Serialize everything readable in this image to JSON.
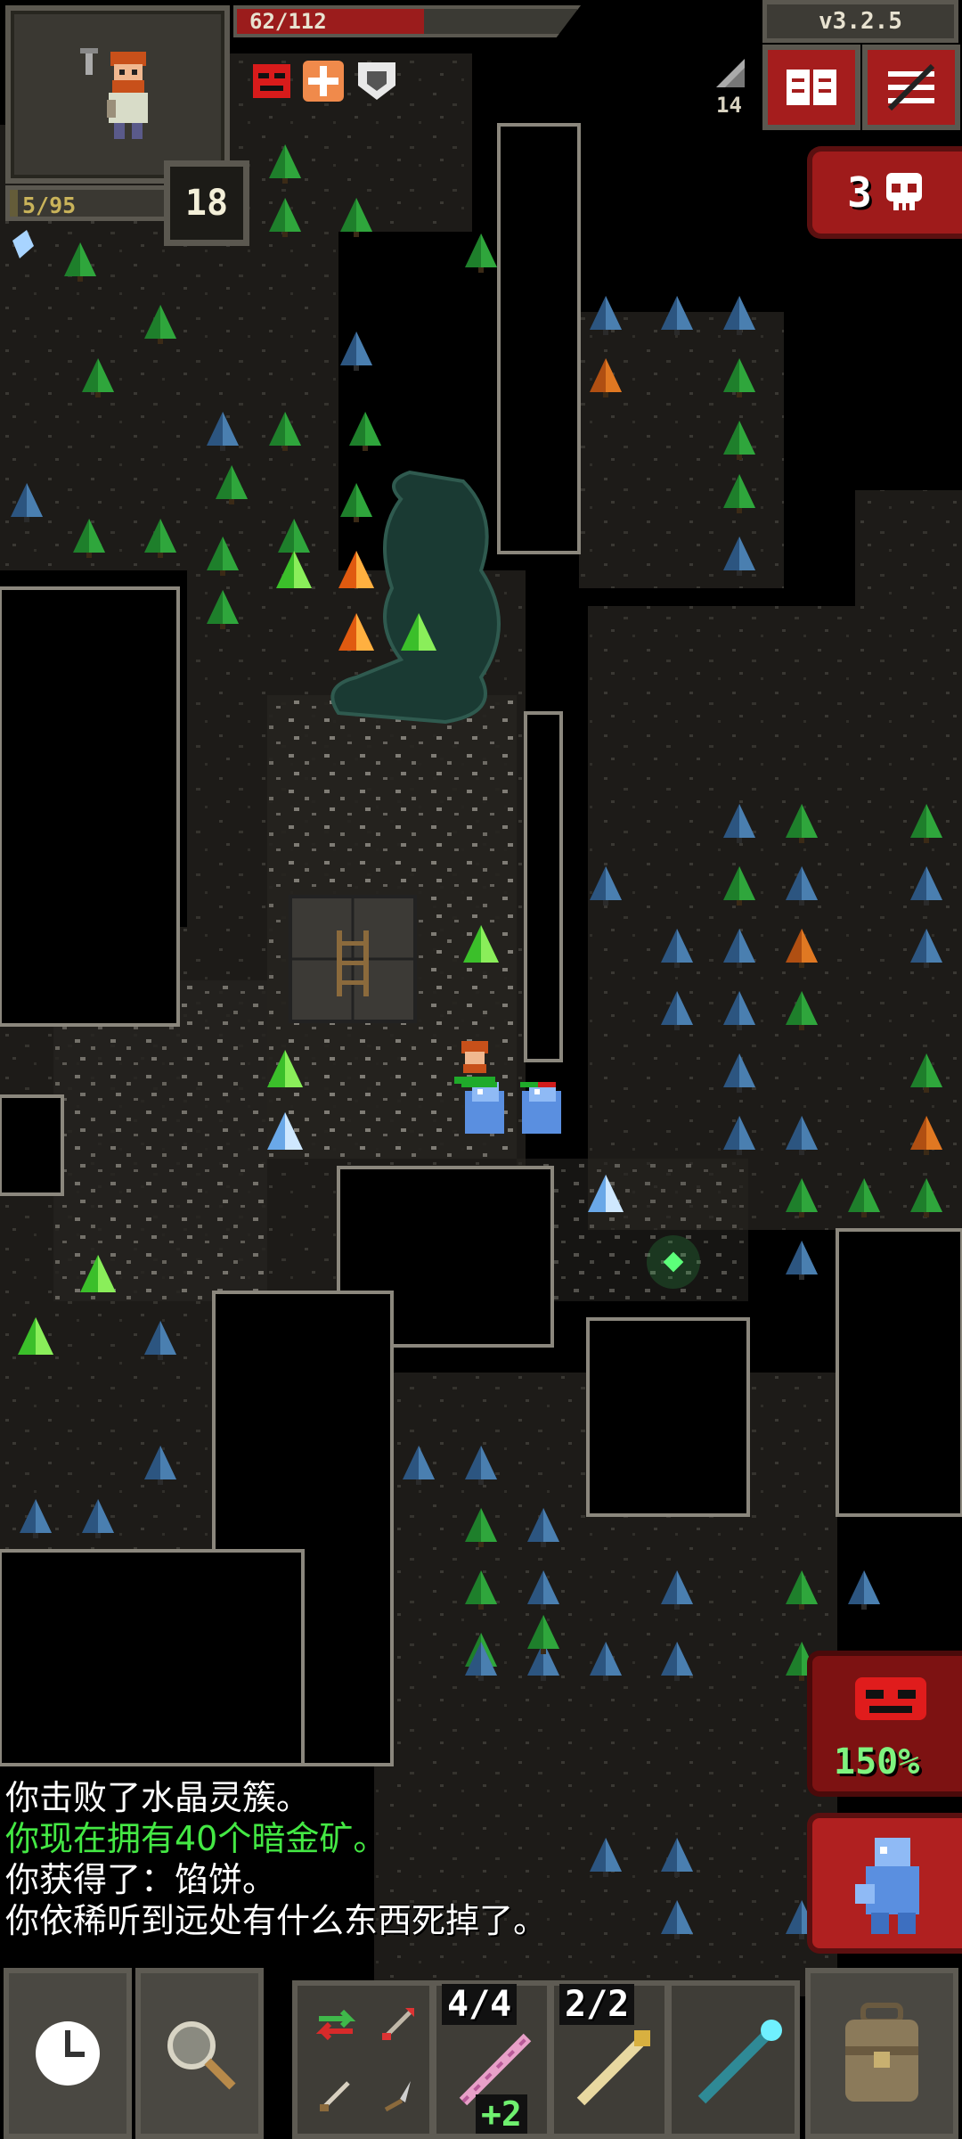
{
  "hero": {
    "hp_text": "62/112",
    "hp_fraction": 0.55,
    "exp_text": "5/95",
    "exp_fraction": 0.05,
    "level": "18"
  },
  "buffs": [
    {
      "icon": "rage-mask-icon",
      "color": "#d81b1b"
    },
    {
      "icon": "cross-shield-icon",
      "color": "#f08a4b"
    },
    {
      "icon": "armor-shield-icon",
      "color": "#e8e8e8"
    }
  ],
  "version": "v3.2.5",
  "depth": "14",
  "top_buttons": [
    {
      "icon": "journal-icon"
    },
    {
      "icon": "menu-icon"
    }
  ],
  "danger": {
    "count": "3",
    "icon": "skull-icon"
  },
  "attack": {
    "percent": "150%",
    "icon": "enemy-mask-icon"
  },
  "target": {
    "icon": "crystal-spirit-icon"
  },
  "log": [
    {
      "text": "你击败了水晶灵簇。",
      "color": "#ffffff"
    },
    {
      "text": "你现在拥有40个暗金矿。",
      "color": "#44e844"
    },
    {
      "text": "你获得了：馅饼。",
      "color": "#ffffff"
    },
    {
      "text": "你依稀听到远处有什么东西死掉了。",
      "color": "#ffffff"
    }
  ],
  "toolbar": {
    "wait_icon": "clock-icon",
    "search_icon": "magnifier-icon",
    "quickslots": [
      {
        "icon": "swap-arrows-icon"
      },
      {
        "icon": "dart-icon"
      },
      {
        "icon": "throwing-knife-icon"
      },
      {
        "icon": "spear-tip-icon"
      }
    ],
    "wand1": {
      "count": "4/4",
      "bonus": "+2",
      "icon": "pink-wand-icon"
    },
    "wand2": {
      "count": "2/2",
      "icon": "gold-wand-icon"
    },
    "wand3": {
      "icon": "cyan-wand-icon"
    },
    "backpack_icon": "backpack-icon"
  },
  "colors": {
    "floor": "#1f1d1a",
    "wall": "#55524c",
    "tree_green": "#1f7a2a",
    "tree_blue": "#2f5a84",
    "tree_orange": "#c05a18",
    "ui_red": "#a51d1d",
    "ui_frame": "#5b5850"
  }
}
